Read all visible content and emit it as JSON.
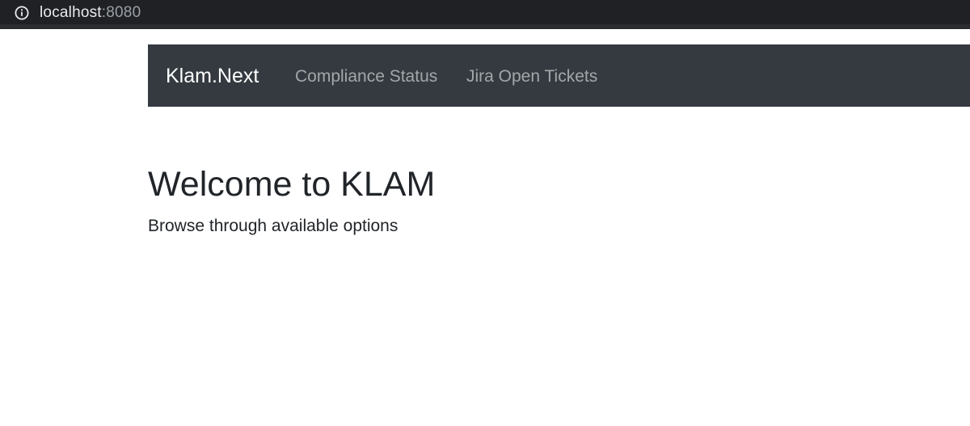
{
  "browser": {
    "url_host": "localhost",
    "url_port": ":8080",
    "icon": "info-icon"
  },
  "navbar": {
    "brand": "Klam.Next",
    "links": [
      {
        "label": "Compliance Status"
      },
      {
        "label": "Jira Open Tickets"
      }
    ],
    "background_color": "#343a40"
  },
  "main": {
    "title": "Welcome to KLAM",
    "subtitle": "Browse through available options"
  }
}
